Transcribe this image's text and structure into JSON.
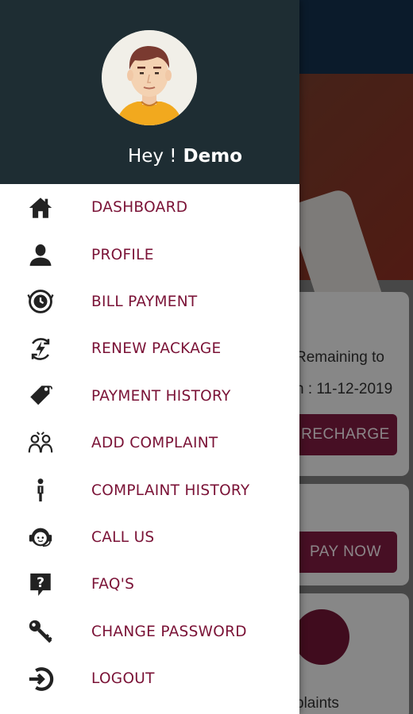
{
  "drawer": {
    "greeting": "Hey !",
    "user_name": "Demo",
    "items": [
      {
        "label": "DASHBOARD",
        "icon": "home-icon"
      },
      {
        "label": "PROFILE",
        "icon": "person-icon"
      },
      {
        "label": "BILL PAYMENT",
        "icon": "bill-clock-icon"
      },
      {
        "label": "RENEW PACKAGE",
        "icon": "renew-bolt-icon"
      },
      {
        "label": "PAYMENT HISTORY",
        "icon": "tag-icon"
      },
      {
        "label": "ADD COMPLAINT",
        "icon": "complaint-people-icon"
      },
      {
        "label": "COMPLAINT HISTORY",
        "icon": "standing-person-icon"
      },
      {
        "label": "CALL US",
        "icon": "headset-icon"
      },
      {
        "label": "FAQ'S",
        "icon": "question-bubble-icon"
      },
      {
        "label": "CHANGE PASSWORD",
        "icon": "key-icon"
      },
      {
        "label": "LOGOUT",
        "icon": "logout-icon"
      }
    ]
  },
  "background": {
    "card1_line1": "Remaining to",
    "card1_line2": "n : 11-12-2019",
    "recharge_button": "RECHARGE",
    "pay_now_button": "PAY NOW",
    "card3_text": "plaints"
  },
  "colors": {
    "header_bg": "#1e2d33",
    "menu_text": "#7a1236",
    "accent": "#7a1a3e"
  }
}
